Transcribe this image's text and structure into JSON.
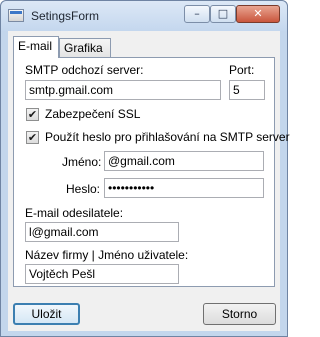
{
  "window": {
    "title": "SetingsForm",
    "minimize_glyph": "–",
    "maximize_glyph": "□",
    "close_glyph": "✕"
  },
  "tabs": [
    {
      "label": "E-mail",
      "active": true
    },
    {
      "label": "Grafika",
      "active": false
    }
  ],
  "smtp": {
    "server_label": "SMTP odchozí server:",
    "server_value": "smtp.gmail.com",
    "port_label": "Port:",
    "port_value": "5"
  },
  "options": {
    "ssl_label": "Zabezpečení SSL",
    "ssl_checked": true,
    "auth_label": "Použít heslo pro přihlašování na SMTP server",
    "auth_checked": true,
    "check_glyph": "✔"
  },
  "credentials": {
    "username_label": "Jméno:",
    "username_value": "@gmail.com",
    "password_label": "Heslo:",
    "password_value": "•••••••••••"
  },
  "sender": {
    "email_label": "E-mail odesilatele:",
    "email_value": "l@gmail.com",
    "name_label": "Název firmy | Jméno uživatele:",
    "name_value": "Vojtěch Pešl"
  },
  "buttons": {
    "save": "Uložit",
    "cancel": "Storno"
  },
  "colors": {
    "frame": "#c3d6ec",
    "close_button": "#c9563d",
    "default_button_border": "#3c7fb1"
  }
}
